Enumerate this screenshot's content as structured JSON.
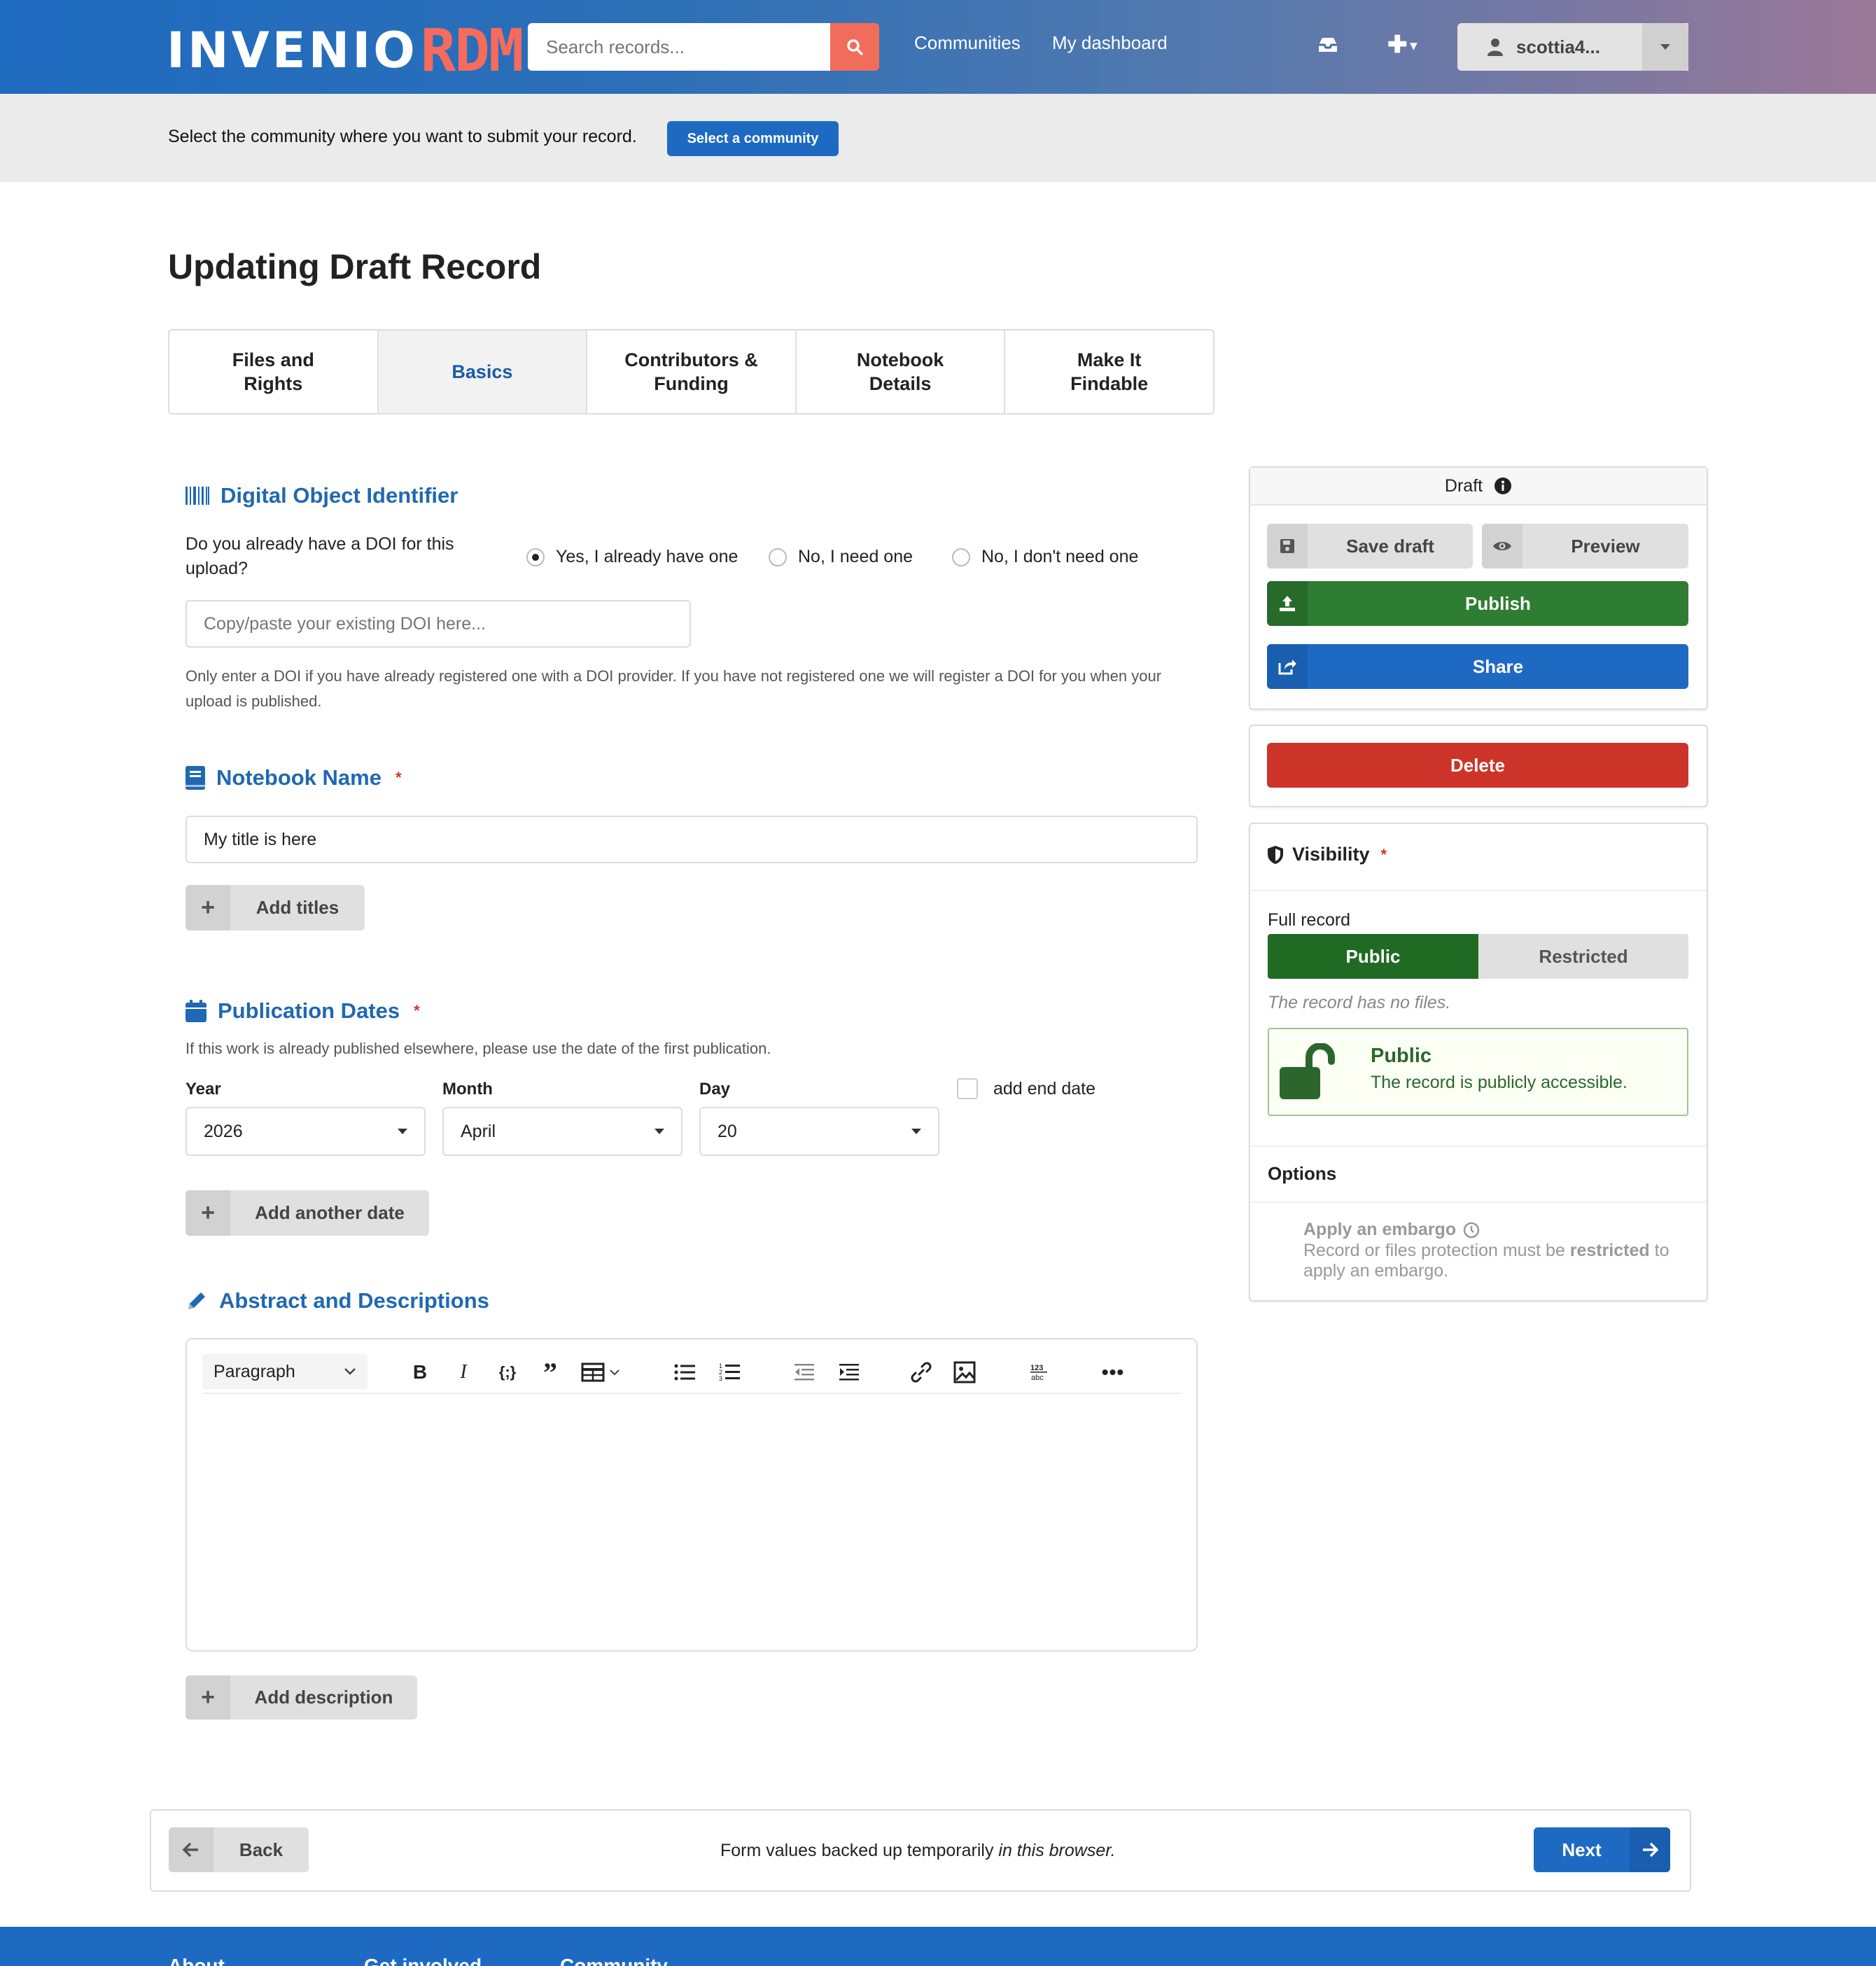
{
  "header": {
    "logo_main": "INVENIO",
    "logo_accent": "RDM",
    "search_placeholder": "Search records...",
    "nav": [
      "Communities",
      "My dashboard"
    ],
    "user": "scottia4..."
  },
  "community_bar": {
    "text": "Select the community where you want to submit your record.",
    "button": "Select a community"
  },
  "page_title": "Updating Draft Record",
  "steps": [
    {
      "label": "Files and Rights",
      "active": false
    },
    {
      "label": "Basics",
      "active": true
    },
    {
      "label": "Contributors & Funding",
      "active": false
    },
    {
      "label": "Notebook Details",
      "active": false
    },
    {
      "label": "Make It Findable",
      "active": false
    }
  ],
  "doi": {
    "heading": "Digital Object Identifier",
    "question": "Do you already have a DOI for this upload?",
    "options": [
      "Yes, I already have one",
      "No, I need one",
      "No, I don't need one"
    ],
    "selected_index": 0,
    "input_placeholder": "Copy/paste your existing DOI here...",
    "help": "Only enter a DOI if you have already registered one with a DOI provider. If you have not registered one we will register a DOI for you when your upload is published."
  },
  "notebook_name": {
    "heading": "Notebook Name",
    "value": "My title is here",
    "add_button": "Add titles"
  },
  "publication_dates": {
    "heading": "Publication Dates",
    "help": "If this work is already published elsewhere, please use the date of the first publication.",
    "year_label": "Year",
    "year": "2026",
    "month_label": "Month",
    "month": "April",
    "day_label": "Day",
    "day": "20",
    "end_date_label": "add end date",
    "add_button": "Add another date"
  },
  "abstract": {
    "heading": "Abstract and Descriptions",
    "block_format": "Paragraph",
    "add_button": "Add description"
  },
  "sidebar": {
    "status": "Draft",
    "save_draft": "Save draft",
    "preview": "Preview",
    "publish": "Publish",
    "share": "Share",
    "delete": "Delete",
    "visibility_heading": "Visibility",
    "full_record_label": "Full record",
    "public_toggle": "Public",
    "restricted_toggle": "Restricted",
    "no_files_note": "The record has no files.",
    "public_title": "Public",
    "public_desc": "The record is publicly accessible.",
    "options_heading": "Options",
    "embargo_title": "Apply an embargo",
    "embargo_desc_1": "Record or files protection must be ",
    "embargo_desc_bold": "restricted",
    "embargo_desc_2": " to apply an embargo."
  },
  "bottom": {
    "back": "Back",
    "note_1": "Form values backed up temporarily ",
    "note_italic": "in this browser.",
    "next": "Next"
  },
  "footer_links": [
    "About",
    "Get involved",
    "Community"
  ],
  "colors": {
    "primary": "#1e6ac3",
    "publish_green": "#2e7d32",
    "delete_red": "#cc3329",
    "accent_coral": "#f26c5b"
  }
}
